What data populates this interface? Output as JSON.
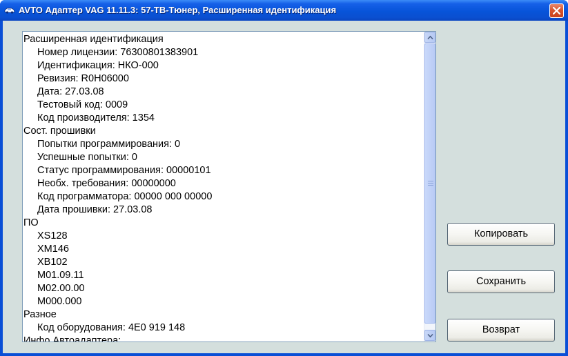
{
  "window": {
    "title": "AVTO Адаптер VAG 11.11.3: 57-TB-Тюнер,  Расширенная идентификация"
  },
  "icons": {
    "title": "car-key-icon",
    "close": "close-icon",
    "scroll_up": "chevron-up-icon",
    "scroll_down": "chevron-down-icon"
  },
  "colors": {
    "titlebar": "#0a4fd6",
    "close_button": "#d9552f",
    "client_background": "#d4dfdd"
  },
  "list": {
    "lines": [
      {
        "text": "Расширенная идентификация",
        "indent": false
      },
      {
        "text": "Номер лицензии: 76300801383901",
        "indent": true
      },
      {
        "text": "Идентификация: НКО-000",
        "indent": true
      },
      {
        "text": "Ревизия: R0H06000",
        "indent": true
      },
      {
        "text": "Дата: 27.03.08",
        "indent": true
      },
      {
        "text": "Тестовый код: 0009",
        "indent": true
      },
      {
        "text": "Код производителя: 1354",
        "indent": true
      },
      {
        "text": "Сост. прошивки",
        "indent": false
      },
      {
        "text": "Попытки программирования: 0",
        "indent": true
      },
      {
        "text": "Успешные попытки: 0",
        "indent": true
      },
      {
        "text": "Статус программирования: 00000101",
        "indent": true
      },
      {
        "text": "Необх. требования: 00000000",
        "indent": true
      },
      {
        "text": "Код программатора: 00000 000 00000",
        "indent": true
      },
      {
        "text": "Дата прошивки: 27.03.08",
        "indent": true
      },
      {
        "text": "ПО",
        "indent": false
      },
      {
        "text": "XS128",
        "indent": true
      },
      {
        "text": "XM146",
        "indent": true
      },
      {
        "text": "XB102",
        "indent": true
      },
      {
        "text": "M01.09.11",
        "indent": true
      },
      {
        "text": "M02.00.00",
        "indent": true
      },
      {
        "text": "M000.000",
        "indent": true
      },
      {
        "text": "Разное",
        "indent": false
      },
      {
        "text": "Код оборудования: 4E0 919 148",
        "indent": true
      },
      {
        "text": "Инфо Автоадаптера:",
        "indent": false
      }
    ]
  },
  "buttons": {
    "copy": "Копировать",
    "save": "Сохранить",
    "back": "Возврат"
  }
}
